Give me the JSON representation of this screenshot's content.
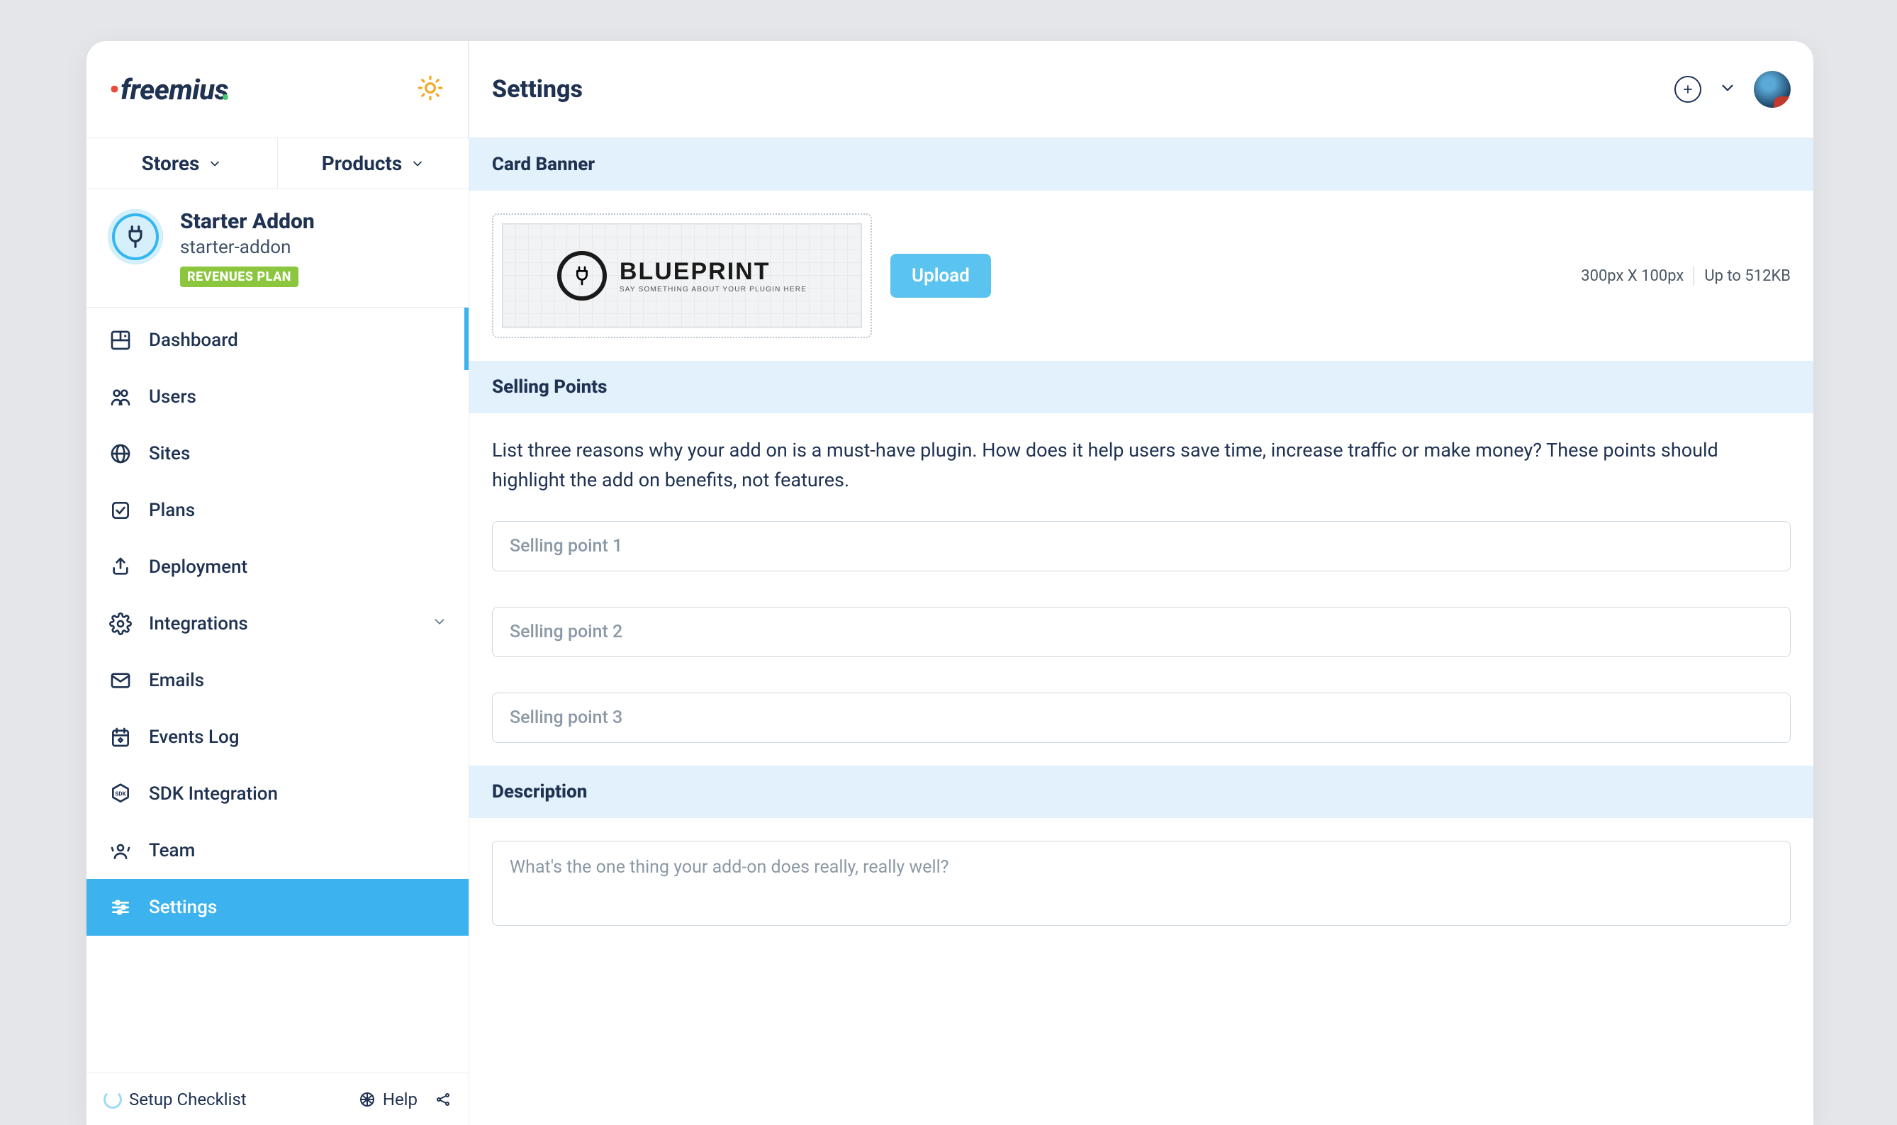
{
  "header": {
    "page_title": "Settings",
    "logo_text": "freemius"
  },
  "selectors": {
    "stores": "Stores",
    "products": "Products"
  },
  "product": {
    "title": "Starter Addon",
    "slug": "starter-addon",
    "badge": "REVENUES PLAN"
  },
  "nav": {
    "dashboard": "Dashboard",
    "users": "Users",
    "sites": "Sites",
    "plans": "Plans",
    "deployment": "Deployment",
    "integrations": "Integrations",
    "emails": "Emails",
    "events_log": "Events Log",
    "sdk": "SDK Integration",
    "team": "Team",
    "settings": "Settings"
  },
  "footer": {
    "setup": "Setup Checklist",
    "help": "Help"
  },
  "sections": {
    "card_banner": {
      "title": "Card Banner",
      "blueprint_big": "BLUEPRINT",
      "blueprint_small": "SAY SOMETHING ABOUT YOUR PLUGIN HERE",
      "upload": "Upload",
      "dim_hint": "300px X 100px",
      "size_hint": "Up to 512KB"
    },
    "selling_points": {
      "title": "Selling Points",
      "help": "List three reasons why your add on is a must-have plugin. How does it help users save time, increase traffic or make money? These points should highlight the add on benefits, not features.",
      "p1": "Selling point 1",
      "p2": "Selling point 2",
      "p3": "Selling point 3"
    },
    "description": {
      "title": "Description",
      "placeholder": "What's the one thing your add-on does really, really well?"
    }
  }
}
